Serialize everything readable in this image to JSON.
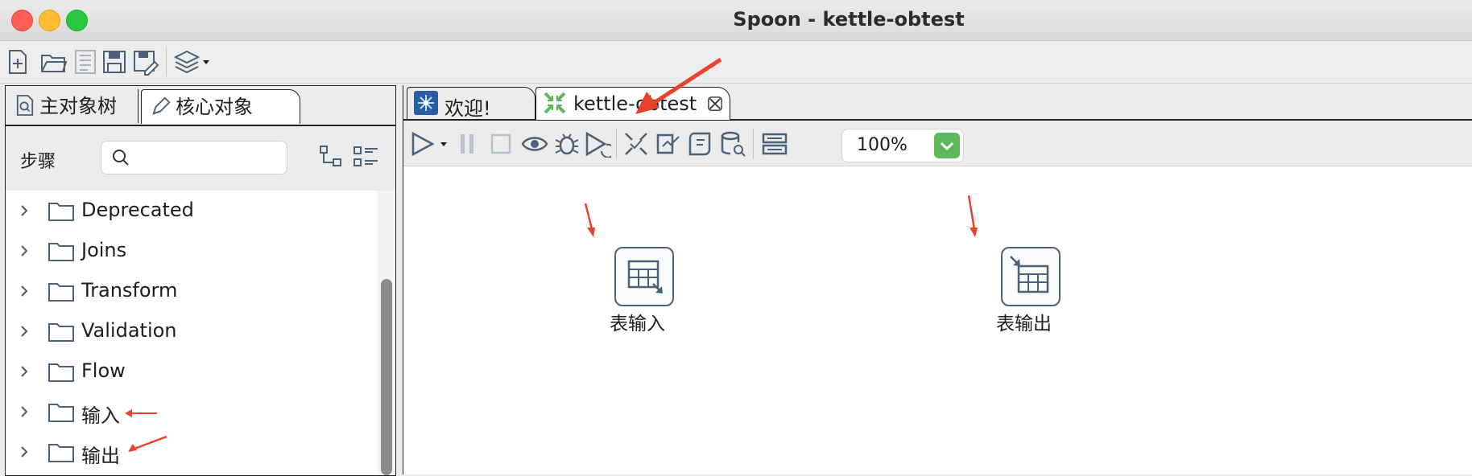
{
  "window": {
    "title": "Spoon - kettle-obtest"
  },
  "left_tabs": [
    {
      "label": "主对象树"
    },
    {
      "label": "核心对象"
    }
  ],
  "steps_panel": {
    "label": "步骤",
    "search_placeholder": ""
  },
  "tree_items": [
    {
      "label": "Deprecated"
    },
    {
      "label": "Joins"
    },
    {
      "label": "Transform"
    },
    {
      "label": "Validation"
    },
    {
      "label": "Flow"
    },
    {
      "label": "输入"
    },
    {
      "label": "输出"
    }
  ],
  "editor_tabs": [
    {
      "label": "欢迎!"
    },
    {
      "label": "kettle-obtest"
    }
  ],
  "zoom": {
    "value": "100%"
  },
  "canvas_steps": [
    {
      "label": "表输入"
    },
    {
      "label": "表输出"
    }
  ],
  "colors": {
    "accent_green": "#5cb85c",
    "annotation_red": "#e8412c",
    "icon_slate": "#4b6177"
  }
}
